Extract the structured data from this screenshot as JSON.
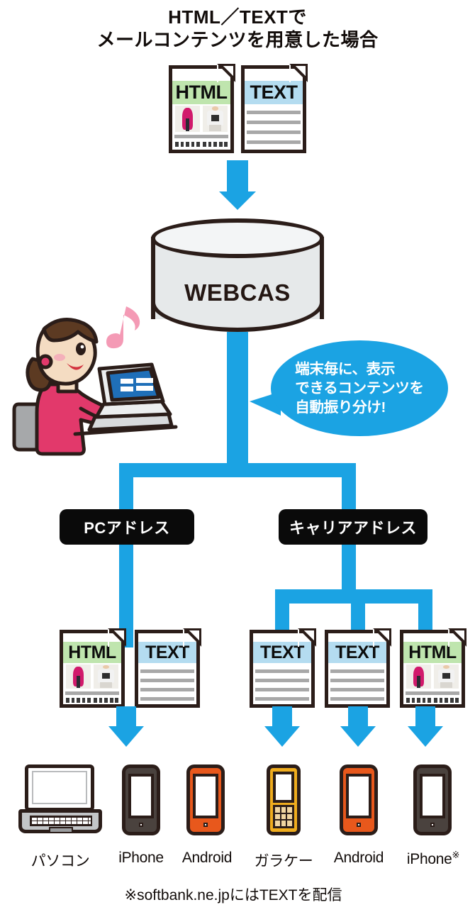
{
  "title": {
    "line1": "HTML／TEXTで",
    "line2": "メールコンテンツを用意した場合"
  },
  "colors": {
    "flow_blue": "#1ba3e3",
    "html_header": "#bfe5ae",
    "text_header": "#b4dcf0",
    "label_black": "#0a0a0a",
    "outline": "#2b1d19",
    "android_orange": "#e8581c",
    "iphone_dark": "#4a423e",
    "feature_yellow": "#f0ad1e"
  },
  "source_documents": [
    {
      "type": "HTML",
      "label": "HTML",
      "style": "green"
    },
    {
      "type": "TEXT",
      "label": "TEXT",
      "style": "blue"
    }
  ],
  "system": {
    "name": "WEBCAS"
  },
  "operator": {
    "alt": "woman-at-laptop-illustration",
    "note_icon": "music-note-icon"
  },
  "bubble": {
    "line1": "端末毎に、表示",
    "line2": "できるコンテンツを",
    "line3": "自動振り分け!"
  },
  "branches": [
    {
      "id": "pc",
      "label": "PCアドレス"
    },
    {
      "id": "carrier",
      "label": "キャリアアドレス"
    }
  ],
  "delivered_documents": [
    {
      "branch": "pc",
      "label": "HTML",
      "style": "green"
    },
    {
      "branch": "pc",
      "label": "TEXT",
      "style": "blue"
    },
    {
      "branch": "carrier",
      "label": "TEXT",
      "style": "blue"
    },
    {
      "branch": "carrier",
      "label": "TEXT",
      "style": "blue"
    },
    {
      "branch": "carrier",
      "label": "HTML",
      "style": "green"
    }
  ],
  "devices": [
    {
      "label": "パソコン",
      "kind": "laptop",
      "color": "#c3c5c7",
      "note": ""
    },
    {
      "label": "iPhone",
      "kind": "smartphone",
      "color": "#4a423e",
      "note": ""
    },
    {
      "label": "Android",
      "kind": "smartphone",
      "color": "#e8581c",
      "note": ""
    },
    {
      "label": "ガラケー",
      "kind": "feature-phone",
      "color": "#f0ad1e",
      "note": ""
    },
    {
      "label": "Android",
      "kind": "smartphone",
      "color": "#e8581c",
      "note": ""
    },
    {
      "label": "iPhone",
      "kind": "smartphone",
      "color": "#4a423e",
      "note": "※"
    }
  ],
  "footnote": "※softbank.ne.jpにはTEXTを配信"
}
